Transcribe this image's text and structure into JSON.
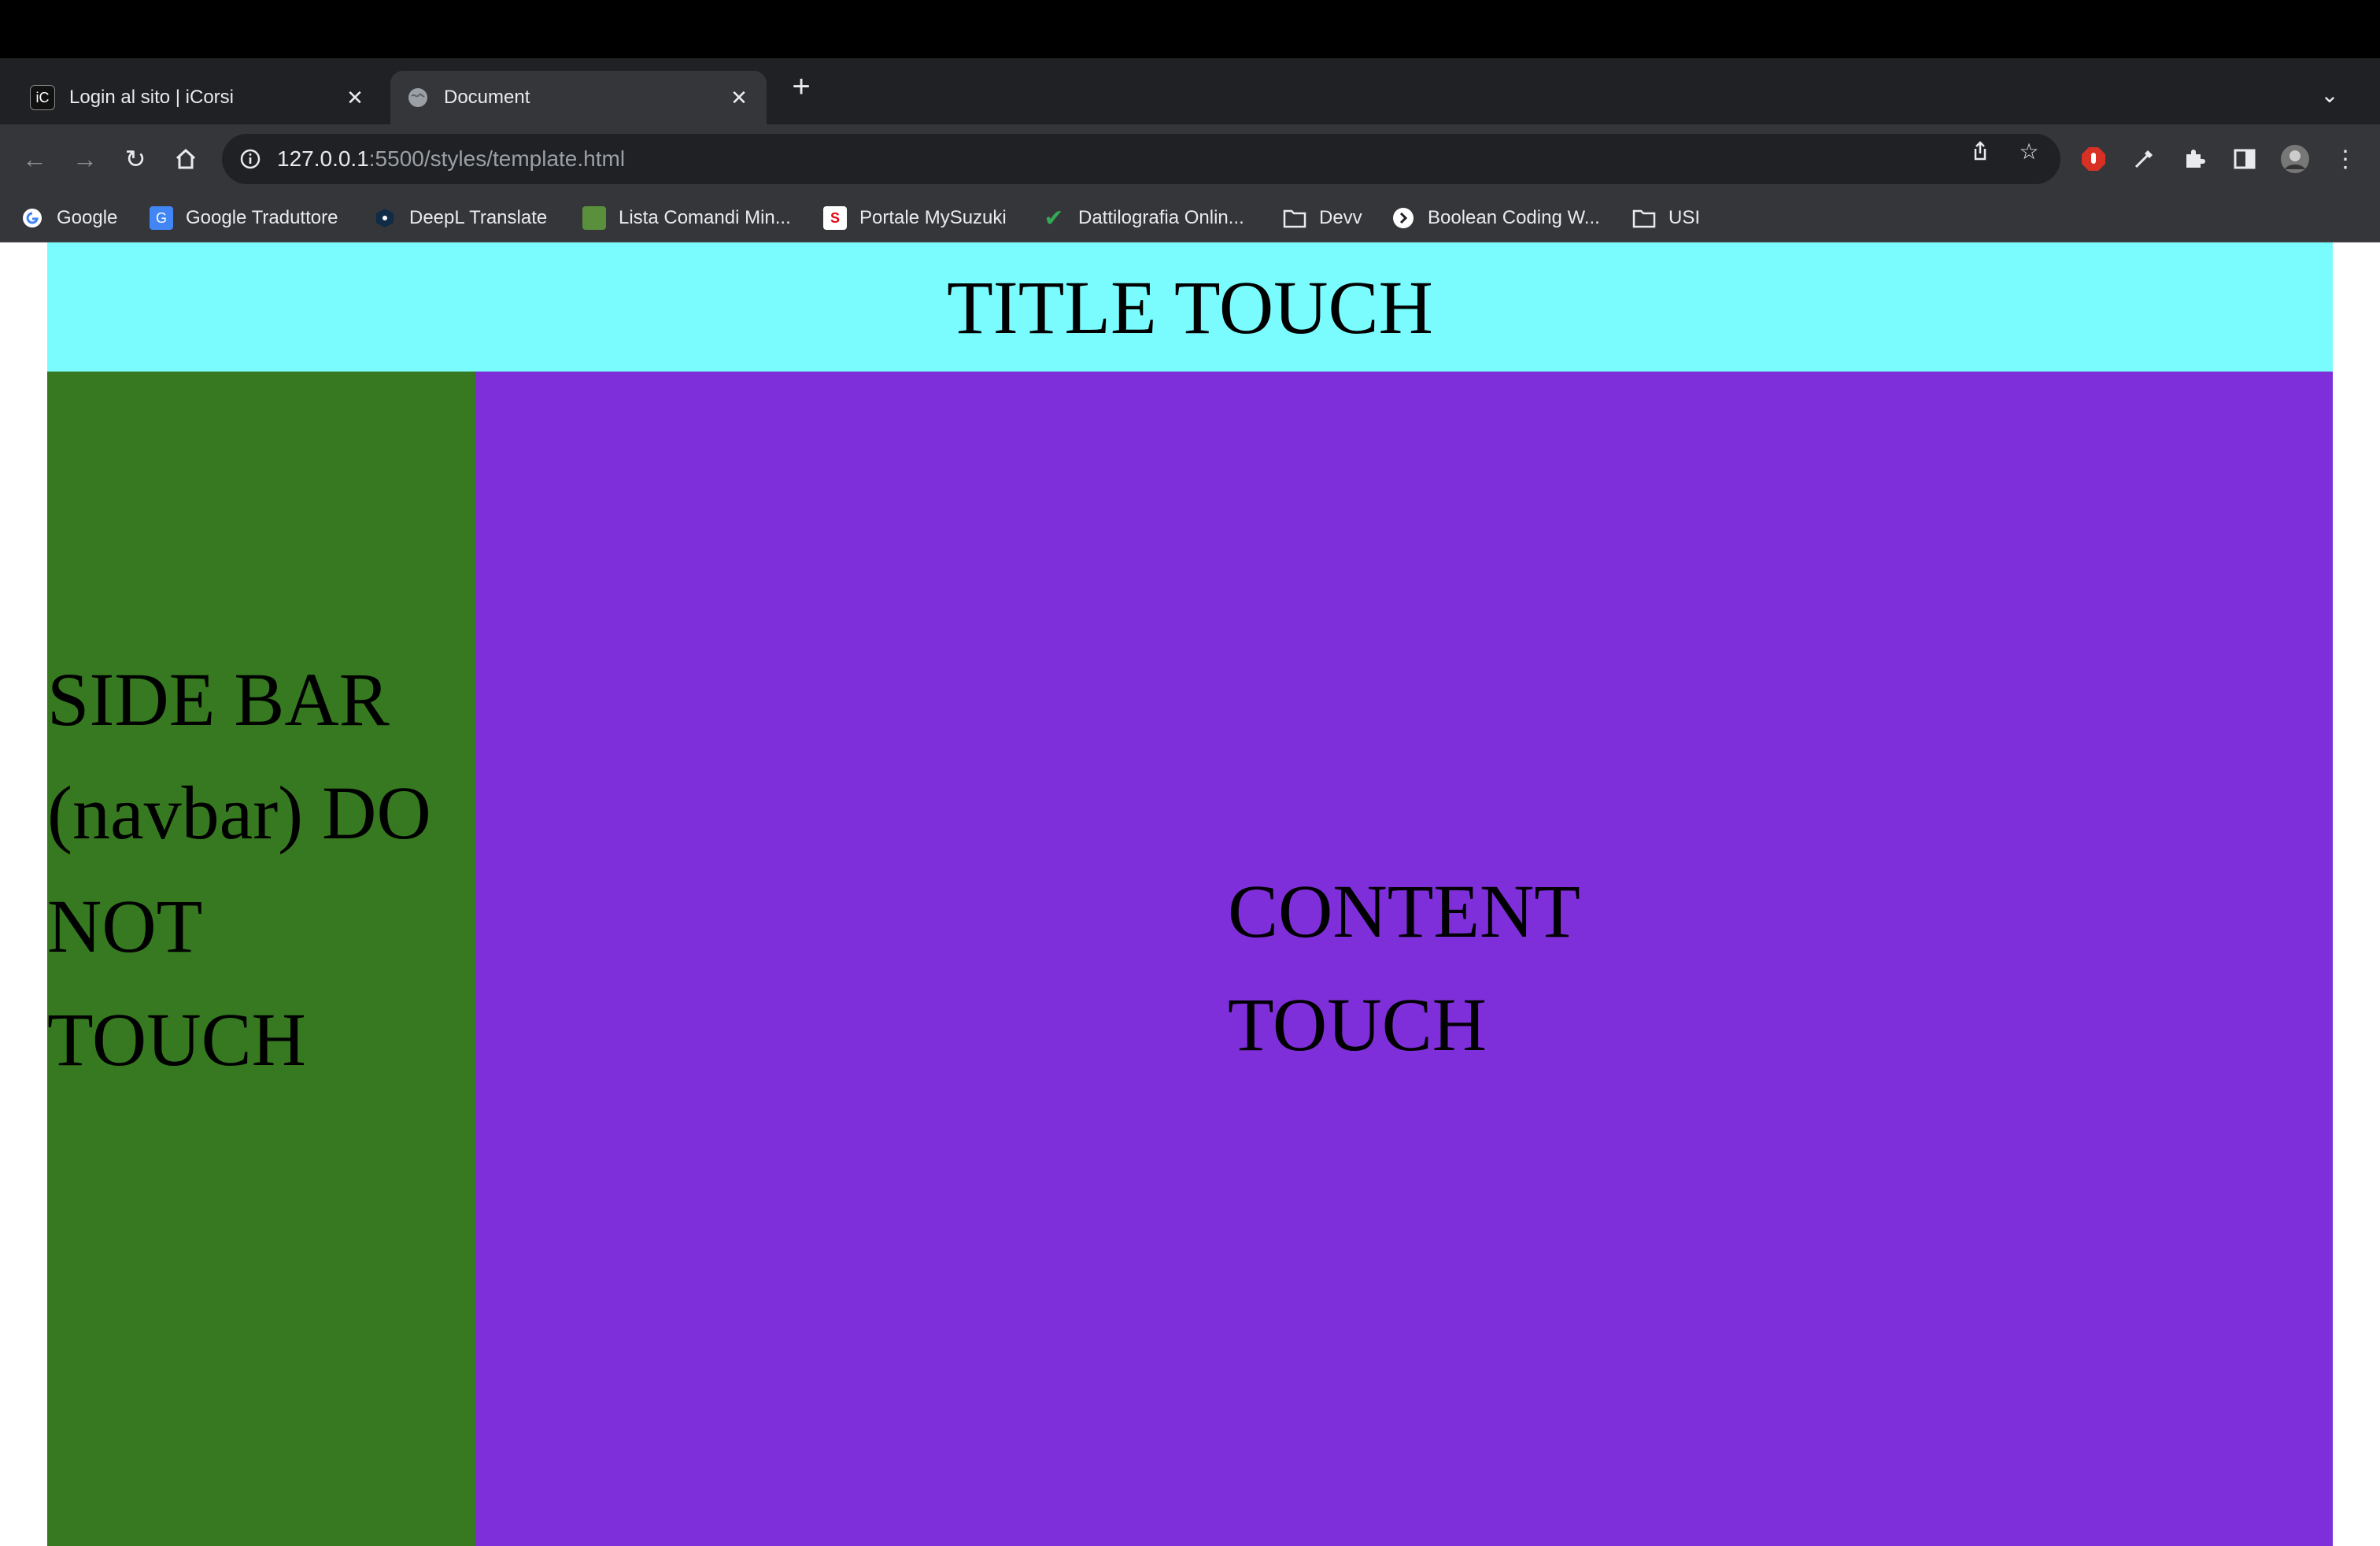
{
  "browser": {
    "tabs": [
      {
        "title": "Login al sito | iCorsi",
        "favicon": "iC",
        "active": false
      },
      {
        "title": "Document",
        "favicon": "globe-icon",
        "active": true
      }
    ],
    "address_bar": {
      "host": "127.0.0.1",
      "path": ":5500/styles/template.html"
    },
    "bookmarks": [
      {
        "label": "Google",
        "icon": "google-icon"
      },
      {
        "label": "Google Traduttore",
        "icon": "translate-icon"
      },
      {
        "label": "DeepL Translate",
        "icon": "deepl-icon"
      },
      {
        "label": "Lista Comandi Min...",
        "icon": "minecraft-icon"
      },
      {
        "label": "Portale MySuzuki",
        "icon": "suzuki-icon"
      },
      {
        "label": "Dattilografia Onlin...",
        "icon": "check-icon"
      },
      {
        "label": "Devv",
        "icon": "folder-icon"
      },
      {
        "label": "Boolean Coding W...",
        "icon": "boolean-icon"
      },
      {
        "label": "USI",
        "icon": "folder-icon"
      }
    ]
  },
  "page": {
    "header": {
      "text": "TITLE TOUCH",
      "color": "#7afcff"
    },
    "sidebar": {
      "text": "SIDE BAR (navbar) DO NOT TOUCH",
      "color": "#367920"
    },
    "content": {
      "text": "CONTENT TOUCH",
      "color": "#7f2fd9"
    }
  }
}
